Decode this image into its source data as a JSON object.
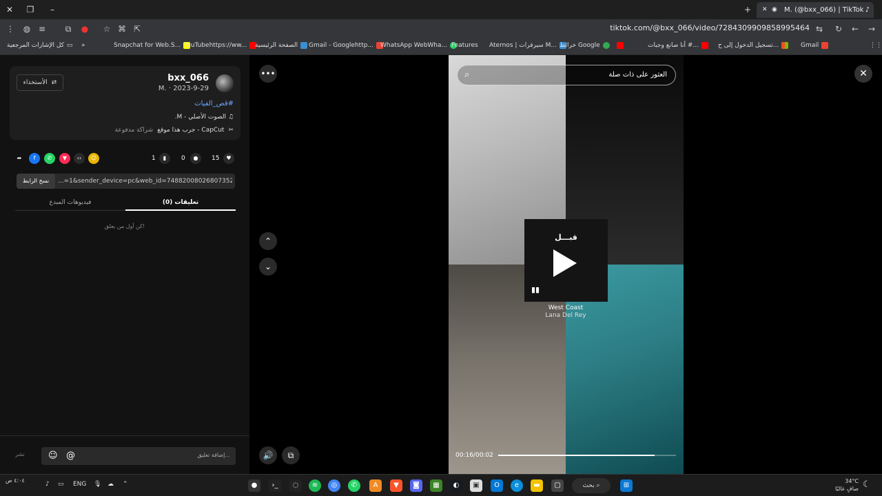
{
  "browser": {
    "tab_title": "M. (@bxx_066) | TikTok",
    "url": "tiktok.com/@bxx_066/video/7284309909858995464",
    "bookmarks": [
      "Gmail",
      "تسجيل الدخول إلى ح...",
      "أنا صانع وجبات #...",
      "خرائط Google",
      "Aternos | سيرفرات M...",
      "Features",
      "WhatsApp WebWha...",
      "Gmail - Googlehttp...",
      "الصفحة الرئيسية",
      "YouTubehttps://ww...",
      "Snapchat for Web.S..."
    ],
    "all_bookmarks": "كل الإشارات المرجعية"
  },
  "post": {
    "author": "bxx_066",
    "date": "M. · 2023-9-29",
    "follow_label": "الأستخذاء",
    "hashtag": "#قص_الفيات",
    "sound": "الصوت الأصلي - M.",
    "capcut_label": "CapCut - جرب هذا موقع",
    "capcut_badge": "شراكة مدفوعة",
    "likes": "15",
    "comments": "0",
    "saves": "1",
    "link_text": "...=1&sender_device=pc&web_id=7488200802680735250",
    "copy_label": "نسخ الرابط",
    "tab_comments": "(0) تعليقات",
    "tab_creator": "فيديوهات المبدع",
    "first_comment": "كن أول من يعلق!",
    "comment_placeholder": "إضافة تعليق...",
    "post_label": "نشر"
  },
  "video": {
    "search_text": "العثور على ذات صلة",
    "music_title": "قبـــل",
    "song_title": "West Coast",
    "song_artist": "Lana Del Rey",
    "time": "00:16/00:02",
    "progress": 0.88
  },
  "taskbar": {
    "lang": "ENG",
    "search": "بحث",
    "weather_temp": "34°C",
    "weather_desc": "صافٍ غالبًا",
    "clock": "٤:٠٤ ص"
  }
}
